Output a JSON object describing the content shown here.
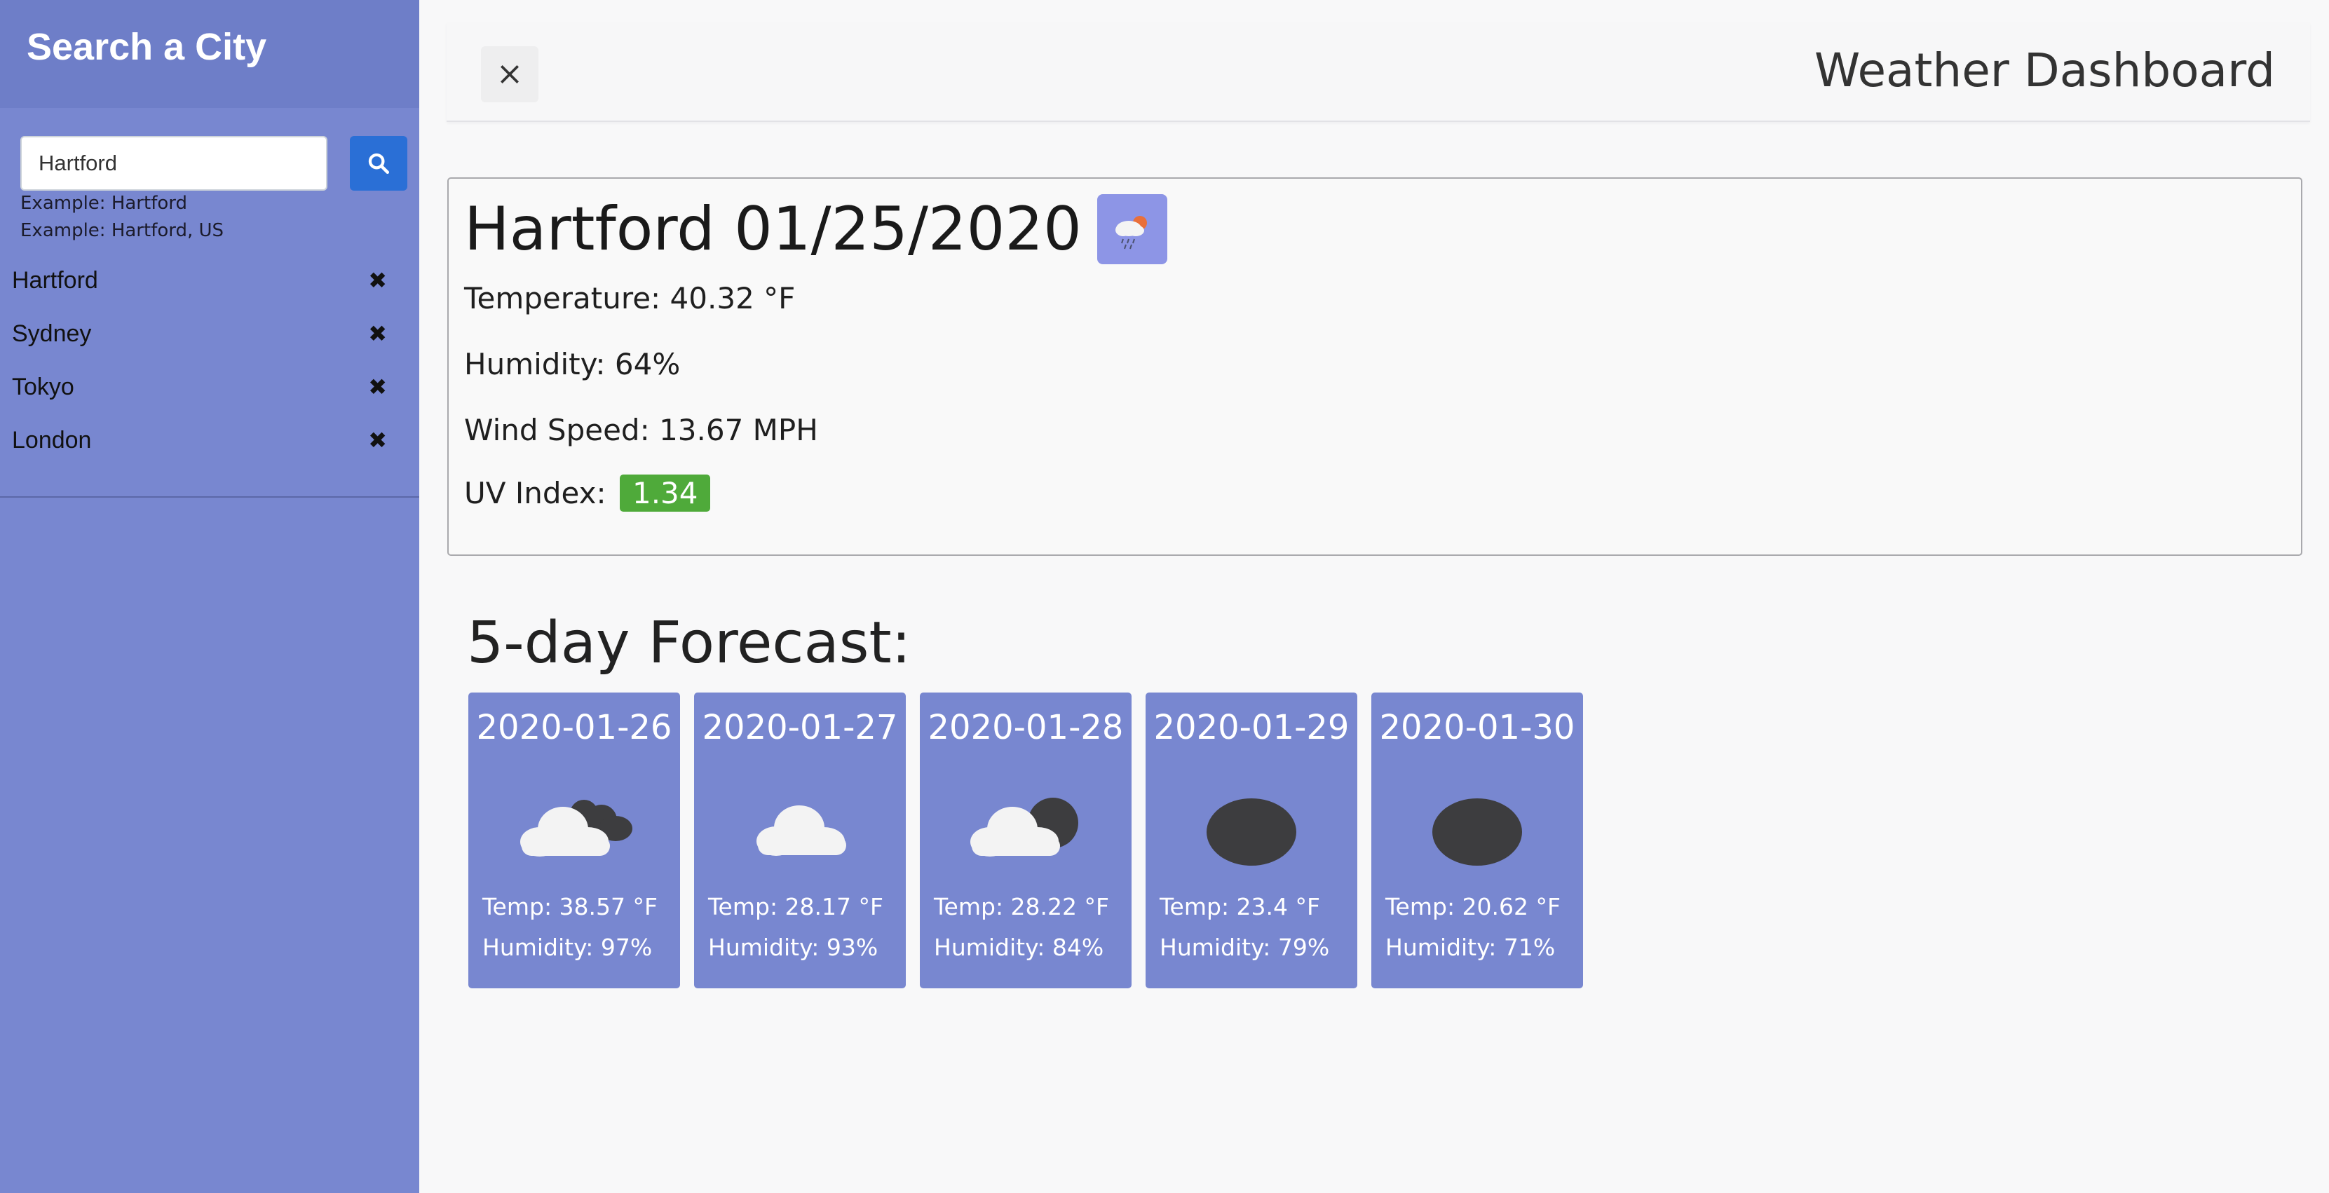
{
  "sidebar": {
    "title": "Search a City",
    "search": {
      "value": "Hartford",
      "placeholder": ""
    },
    "hints": [
      "Example: Hartford",
      "Example: Hartford, US"
    ],
    "cities": [
      "Hartford",
      "Sydney",
      "Tokyo",
      "London"
    ],
    "search_icon": "search-icon",
    "remove_icon": "✖"
  },
  "header": {
    "title": "Weather Dashboard",
    "close_icon": "close-icon"
  },
  "current": {
    "heading": "Hartford 01/25/2020",
    "icon": "rain-cloud-sun-icon",
    "temperature": "Temperature: 40.32 °F",
    "humidity": "Humidity: 64%",
    "wind": "Wind Speed: 13.67 MPH",
    "uv_label": "UV Index:",
    "uv_value": "1.34",
    "uv_color": "#4faa3a"
  },
  "forecast": {
    "title": "5-day Forecast:",
    "days": [
      {
        "date": "2020-01-26",
        "icon": "broken-clouds-icon",
        "temp": "Temp: 38.57 °F",
        "humidity": "Humidity: 97%"
      },
      {
        "date": "2020-01-27",
        "icon": "cloud-icon",
        "temp": "Temp: 28.17 °F",
        "humidity": "Humidity: 93%"
      },
      {
        "date": "2020-01-28",
        "icon": "cloudy-icon",
        "temp": "Temp: 28.22 °F",
        "humidity": "Humidity: 84%"
      },
      {
        "date": "2020-01-29",
        "icon": "overcast-icon",
        "temp": "Temp: 23.4 °F",
        "humidity": "Humidity: 79%"
      },
      {
        "date": "2020-01-30",
        "icon": "overcast-icon",
        "temp": "Temp: 20.62 °F",
        "humidity": "Humidity: 71%"
      }
    ]
  },
  "colors": {
    "sidebar": "#7887d0",
    "search_button": "#2a6fd6",
    "card": "#7887d0"
  }
}
